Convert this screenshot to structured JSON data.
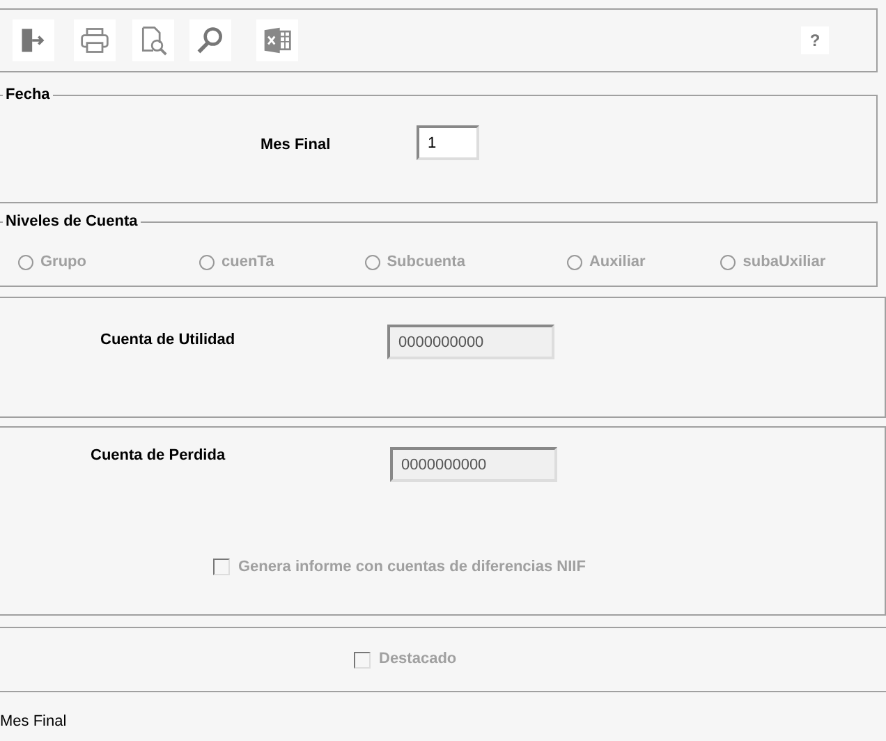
{
  "toolbar": {
    "buttons": [
      {
        "kind": "exit"
      },
      {
        "kind": "print"
      },
      {
        "kind": "preview"
      },
      {
        "kind": "search"
      },
      {
        "kind": "excel"
      }
    ],
    "help": "?"
  },
  "fecha": {
    "title": "Fecha",
    "label": "Mes Final",
    "value": "1"
  },
  "niveles": {
    "title": "Niveles de Cuenta",
    "options": [
      {
        "label": "Grupo",
        "selected": false,
        "disabled": true
      },
      {
        "label": "cuenTa",
        "selected": false,
        "disabled": true
      },
      {
        "label": "Subcuenta",
        "selected": false,
        "disabled": true
      },
      {
        "label": "Auxiliar",
        "selected": false,
        "disabled": true
      },
      {
        "label": "subaUxiliar",
        "selected": false,
        "disabled": true
      }
    ]
  },
  "utilidad": {
    "label": "Cuenta de Utilidad",
    "value": "0000000000"
  },
  "perdida": {
    "label": "Cuenta de Perdida",
    "value": "0000000000",
    "checkbox": {
      "label": "Genera informe con cuentas de diferencias NIIF",
      "checked": false,
      "disabled": true
    }
  },
  "destacado": {
    "label": "Destacado",
    "checked": false,
    "disabled": true
  },
  "status_bar": "Mes Final"
}
